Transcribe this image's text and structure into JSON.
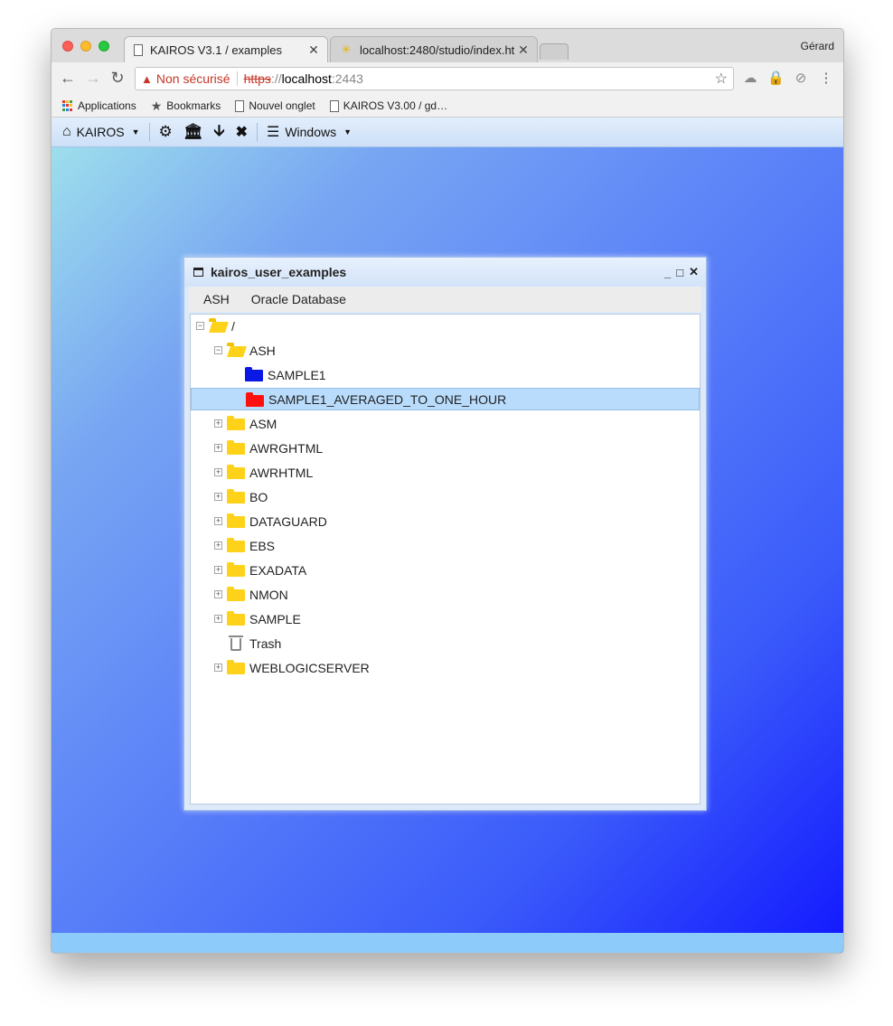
{
  "browser": {
    "profile_name": "Gérard",
    "tabs": [
      {
        "title": "KAIROS V3.1 / examples",
        "active": true
      },
      {
        "title": "localhost:2480/studio/index.ht",
        "active": false
      }
    ],
    "address": {
      "security_label": "Non sécurisé",
      "scheme": "https",
      "scheme_sep": "://",
      "host": "localhost",
      "port": ":2443"
    },
    "bookmarks": [
      {
        "label": "Applications",
        "icon": "apps-grid-icon"
      },
      {
        "label": "Bookmarks",
        "icon": "star-icon"
      },
      {
        "label": "Nouvel onglet",
        "icon": "page-icon"
      },
      {
        "label": "KAIROS V3.00 / gd…",
        "icon": "page-icon"
      }
    ]
  },
  "app": {
    "toolbar": {
      "home_label": "KAIROS",
      "windows_label": "Windows"
    },
    "dialog": {
      "title": "kairos_user_examples",
      "menu": [
        "ASH",
        "Oracle Database"
      ],
      "tree": [
        {
          "label": "/",
          "level": 0,
          "type": "folder-open",
          "expander": "minus"
        },
        {
          "label": "ASH",
          "level": 1,
          "type": "folder-open",
          "expander": "minus"
        },
        {
          "label": "SAMPLE1",
          "level": 2,
          "type": "folder-blue",
          "expander": "none"
        },
        {
          "label": "SAMPLE1_AVERAGED_TO_ONE_HOUR",
          "level": 2,
          "type": "folder-red",
          "expander": "none",
          "selected": true
        },
        {
          "label": "ASM",
          "level": 1,
          "type": "folder",
          "expander": "plus"
        },
        {
          "label": "AWRGHTML",
          "level": 1,
          "type": "folder",
          "expander": "plus"
        },
        {
          "label": "AWRHTML",
          "level": 1,
          "type": "folder",
          "expander": "plus"
        },
        {
          "label": "BO",
          "level": 1,
          "type": "folder",
          "expander": "plus"
        },
        {
          "label": "DATAGUARD",
          "level": 1,
          "type": "folder",
          "expander": "plus"
        },
        {
          "label": "EBS",
          "level": 1,
          "type": "folder",
          "expander": "plus"
        },
        {
          "label": "EXADATA",
          "level": 1,
          "type": "folder",
          "expander": "plus"
        },
        {
          "label": "NMON",
          "level": 1,
          "type": "folder",
          "expander": "plus"
        },
        {
          "label": "SAMPLE",
          "level": 1,
          "type": "folder",
          "expander": "plus"
        },
        {
          "label": "Trash",
          "level": 1,
          "type": "trash",
          "expander": "none"
        },
        {
          "label": "WEBLOGICSERVER",
          "level": 1,
          "type": "folder",
          "expander": "plus"
        }
      ]
    }
  },
  "colors": {
    "folder_yellow": "#ffd21a",
    "folder_blue": "#0a18e6",
    "folder_red": "#ff1010",
    "selection": "#b9dcfc"
  }
}
